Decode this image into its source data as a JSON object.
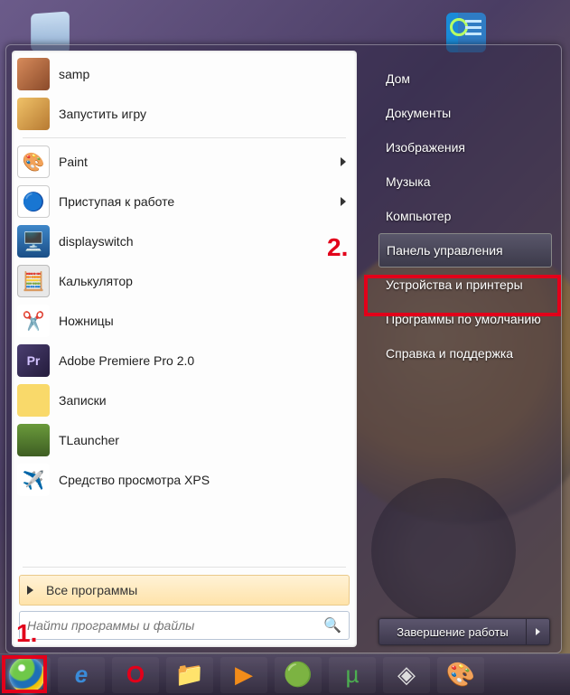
{
  "desktop": {
    "icons": [
      "my-computer",
      "control-panel-shortcut"
    ]
  },
  "start_menu": {
    "pinned": [
      {
        "label": "samp",
        "icon": "samp"
      },
      {
        "label": "Запустить игру",
        "icon": "launch"
      }
    ],
    "recent": [
      {
        "label": "Paint",
        "icon": "paint",
        "has_submenu": true
      },
      {
        "label": "Приступая к работе",
        "icon": "start",
        "has_submenu": true
      },
      {
        "label": "displayswitch",
        "icon": "disp",
        "has_submenu": false
      },
      {
        "label": "Калькулятор",
        "icon": "calc",
        "has_submenu": false
      },
      {
        "label": "Ножницы",
        "icon": "snip",
        "has_submenu": false
      },
      {
        "label": "Adobe Premiere Pro 2.0",
        "icon": "prem",
        "has_submenu": false
      },
      {
        "label": "Записки",
        "icon": "notes",
        "has_submenu": false
      },
      {
        "label": "TLauncher",
        "icon": "tl",
        "has_submenu": false
      },
      {
        "label": "Средство просмотра XPS",
        "icon": "xps",
        "has_submenu": false
      }
    ],
    "all_programs": "Все программы",
    "search_placeholder": "Найти программы и файлы",
    "right_links": [
      "Дом",
      "Документы",
      "Изображения",
      "Музыка",
      "Компьютер",
      "Панель управления",
      "Устройства и принтеры",
      "Программы по умолчанию",
      "Справка и поддержка"
    ],
    "highlighted_right_index": 5,
    "shutdown_label": "Завершение работы"
  },
  "annotations": {
    "label1": "1.",
    "label2": "2."
  },
  "taskbar": {
    "items": [
      "start",
      "ie",
      "opera",
      "explorer",
      "wmp",
      "chrome",
      "utorrent",
      "unity",
      "paint"
    ]
  }
}
